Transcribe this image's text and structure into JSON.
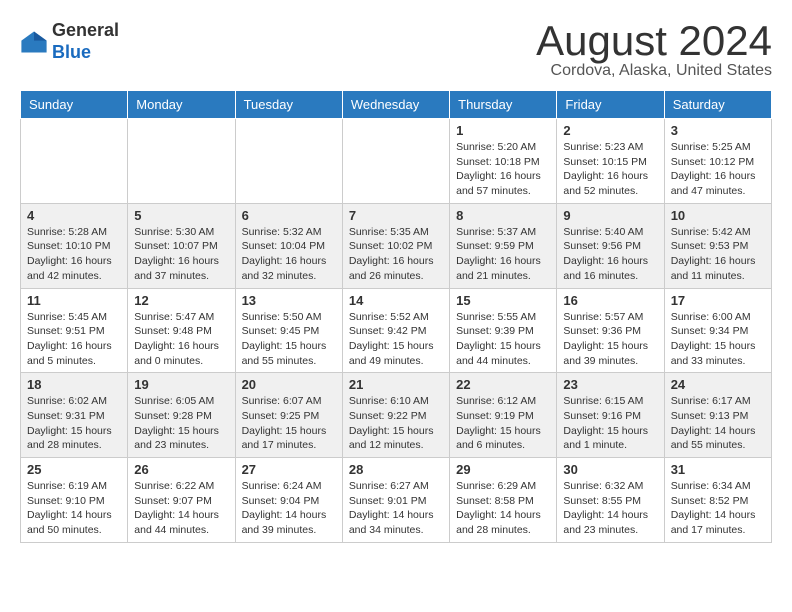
{
  "header": {
    "logo_general": "General",
    "logo_blue": "Blue",
    "month_year": "August 2024",
    "location": "Cordova, Alaska, United States"
  },
  "days_of_week": [
    "Sunday",
    "Monday",
    "Tuesday",
    "Wednesday",
    "Thursday",
    "Friday",
    "Saturday"
  ],
  "weeks": [
    [
      {
        "day": "",
        "detail": ""
      },
      {
        "day": "",
        "detail": ""
      },
      {
        "day": "",
        "detail": ""
      },
      {
        "day": "",
        "detail": ""
      },
      {
        "day": "1",
        "detail": "Sunrise: 5:20 AM\nSunset: 10:18 PM\nDaylight: 16 hours\nand 57 minutes."
      },
      {
        "day": "2",
        "detail": "Sunrise: 5:23 AM\nSunset: 10:15 PM\nDaylight: 16 hours\nand 52 minutes."
      },
      {
        "day": "3",
        "detail": "Sunrise: 5:25 AM\nSunset: 10:12 PM\nDaylight: 16 hours\nand 47 minutes."
      }
    ],
    [
      {
        "day": "4",
        "detail": "Sunrise: 5:28 AM\nSunset: 10:10 PM\nDaylight: 16 hours\nand 42 minutes."
      },
      {
        "day": "5",
        "detail": "Sunrise: 5:30 AM\nSunset: 10:07 PM\nDaylight: 16 hours\nand 37 minutes."
      },
      {
        "day": "6",
        "detail": "Sunrise: 5:32 AM\nSunset: 10:04 PM\nDaylight: 16 hours\nand 32 minutes."
      },
      {
        "day": "7",
        "detail": "Sunrise: 5:35 AM\nSunset: 10:02 PM\nDaylight: 16 hours\nand 26 minutes."
      },
      {
        "day": "8",
        "detail": "Sunrise: 5:37 AM\nSunset: 9:59 PM\nDaylight: 16 hours\nand 21 minutes."
      },
      {
        "day": "9",
        "detail": "Sunrise: 5:40 AM\nSunset: 9:56 PM\nDaylight: 16 hours\nand 16 minutes."
      },
      {
        "day": "10",
        "detail": "Sunrise: 5:42 AM\nSunset: 9:53 PM\nDaylight: 16 hours\nand 11 minutes."
      }
    ],
    [
      {
        "day": "11",
        "detail": "Sunrise: 5:45 AM\nSunset: 9:51 PM\nDaylight: 16 hours\nand 5 minutes."
      },
      {
        "day": "12",
        "detail": "Sunrise: 5:47 AM\nSunset: 9:48 PM\nDaylight: 16 hours\nand 0 minutes."
      },
      {
        "day": "13",
        "detail": "Sunrise: 5:50 AM\nSunset: 9:45 PM\nDaylight: 15 hours\nand 55 minutes."
      },
      {
        "day": "14",
        "detail": "Sunrise: 5:52 AM\nSunset: 9:42 PM\nDaylight: 15 hours\nand 49 minutes."
      },
      {
        "day": "15",
        "detail": "Sunrise: 5:55 AM\nSunset: 9:39 PM\nDaylight: 15 hours\nand 44 minutes."
      },
      {
        "day": "16",
        "detail": "Sunrise: 5:57 AM\nSunset: 9:36 PM\nDaylight: 15 hours\nand 39 minutes."
      },
      {
        "day": "17",
        "detail": "Sunrise: 6:00 AM\nSunset: 9:34 PM\nDaylight: 15 hours\nand 33 minutes."
      }
    ],
    [
      {
        "day": "18",
        "detail": "Sunrise: 6:02 AM\nSunset: 9:31 PM\nDaylight: 15 hours\nand 28 minutes."
      },
      {
        "day": "19",
        "detail": "Sunrise: 6:05 AM\nSunset: 9:28 PM\nDaylight: 15 hours\nand 23 minutes."
      },
      {
        "day": "20",
        "detail": "Sunrise: 6:07 AM\nSunset: 9:25 PM\nDaylight: 15 hours\nand 17 minutes."
      },
      {
        "day": "21",
        "detail": "Sunrise: 6:10 AM\nSunset: 9:22 PM\nDaylight: 15 hours\nand 12 minutes."
      },
      {
        "day": "22",
        "detail": "Sunrise: 6:12 AM\nSunset: 9:19 PM\nDaylight: 15 hours\nand 6 minutes."
      },
      {
        "day": "23",
        "detail": "Sunrise: 6:15 AM\nSunset: 9:16 PM\nDaylight: 15 hours\nand 1 minute."
      },
      {
        "day": "24",
        "detail": "Sunrise: 6:17 AM\nSunset: 9:13 PM\nDaylight: 14 hours\nand 55 minutes."
      }
    ],
    [
      {
        "day": "25",
        "detail": "Sunrise: 6:19 AM\nSunset: 9:10 PM\nDaylight: 14 hours\nand 50 minutes."
      },
      {
        "day": "26",
        "detail": "Sunrise: 6:22 AM\nSunset: 9:07 PM\nDaylight: 14 hours\nand 44 minutes."
      },
      {
        "day": "27",
        "detail": "Sunrise: 6:24 AM\nSunset: 9:04 PM\nDaylight: 14 hours\nand 39 minutes."
      },
      {
        "day": "28",
        "detail": "Sunrise: 6:27 AM\nSunset: 9:01 PM\nDaylight: 14 hours\nand 34 minutes."
      },
      {
        "day": "29",
        "detail": "Sunrise: 6:29 AM\nSunset: 8:58 PM\nDaylight: 14 hours\nand 28 minutes."
      },
      {
        "day": "30",
        "detail": "Sunrise: 6:32 AM\nSunset: 8:55 PM\nDaylight: 14 hours\nand 23 minutes."
      },
      {
        "day": "31",
        "detail": "Sunrise: 6:34 AM\nSunset: 8:52 PM\nDaylight: 14 hours\nand 17 minutes."
      }
    ]
  ]
}
